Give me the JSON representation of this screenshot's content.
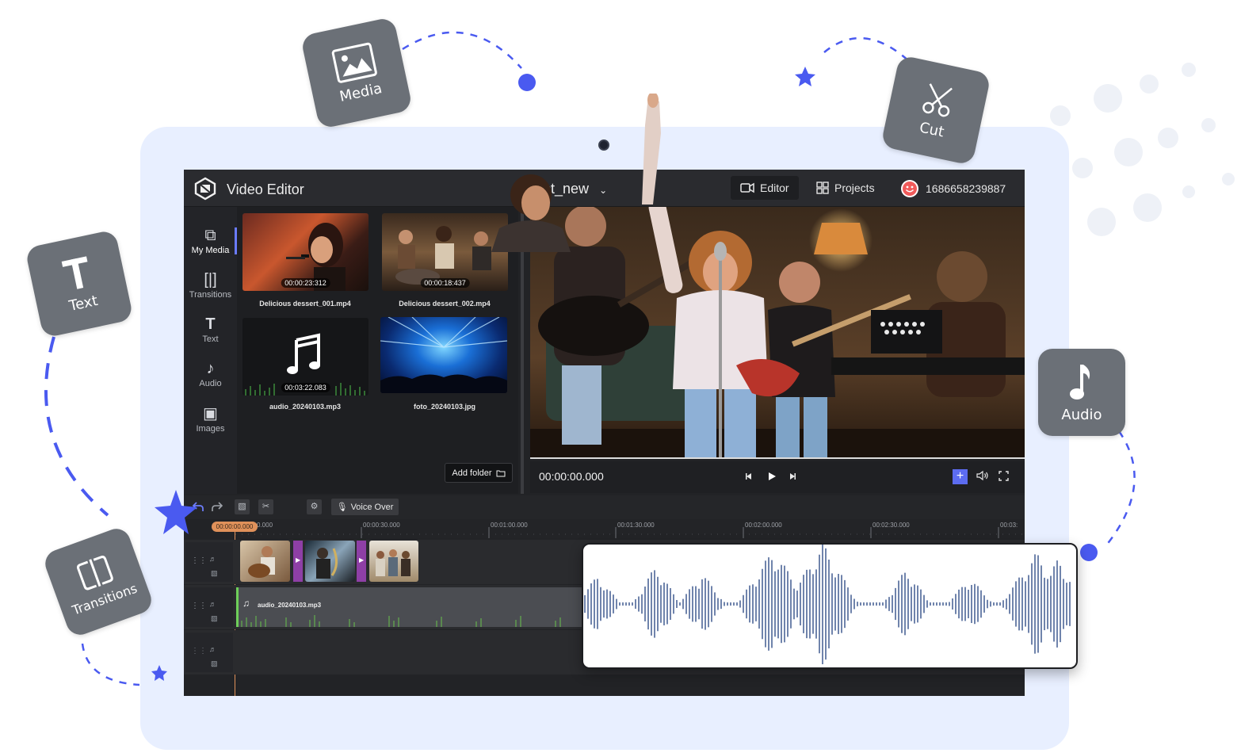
{
  "app": {
    "title": "Video Editor",
    "project_name": "ect_new",
    "tabs": [
      {
        "label": "Editor",
        "active": true
      },
      {
        "label": "Projects",
        "active": false
      }
    ],
    "user_id": "1686658239887"
  },
  "sidebar": {
    "items": [
      {
        "label": "My Media",
        "icon": "media-stack-icon",
        "active": true
      },
      {
        "label": "Transitions",
        "icon": "transition-icon",
        "active": false
      },
      {
        "label": "Text",
        "icon": "text-icon",
        "active": false
      },
      {
        "label": "Audio",
        "icon": "music-note-icon",
        "active": false
      },
      {
        "label": "Images",
        "icon": "image-icon",
        "active": false
      }
    ]
  },
  "media": {
    "items": [
      {
        "name": "Delicious dessert_001.mp4",
        "duration": "00:00:23:312",
        "kind": "video"
      },
      {
        "name": "Delicious dessert_002.mp4",
        "duration": "00:00:18:437",
        "kind": "video"
      },
      {
        "name": "audio_20240103.mp3",
        "duration": "00:03:22.083",
        "kind": "audio"
      },
      {
        "name": "foto_20240103.jpg",
        "duration": "",
        "kind": "image"
      }
    ],
    "add_folder_label": "Add folder"
  },
  "player": {
    "timecode": "00:00:00.000"
  },
  "timeline": {
    "voice_over_label": "Voice Over",
    "playhead_time": "00:00:00.000",
    "ruler_labels": [
      "00:00:30.000",
      "00:01:00.000",
      "00:01:30.000",
      "00:02:00.000",
      "00:02:30.000",
      "00:03:"
    ],
    "ruler_start_fragment": "0.000",
    "audio_clip_name": "audio_20240103.mp3"
  },
  "features": [
    {
      "label": "Media",
      "icon": "image-icon"
    },
    {
      "label": "Cut",
      "icon": "scissors-icon"
    },
    {
      "label": "Text",
      "icon": "text-icon"
    },
    {
      "label": "Audio",
      "icon": "music-note-icon"
    },
    {
      "label": "Transitions",
      "icon": "transition-icon"
    }
  ],
  "colors": {
    "accent": "#5c6cf0",
    "decor_blue": "#4a5af0",
    "tile_gray": "#6b7077",
    "tablet_bg": "#e8efff",
    "editor_bg": "#222326",
    "playhead": "#e0915a",
    "audio_clip_edge": "#6fcf5a",
    "transition_marker": "#8e3fa6",
    "waveform": "#4c6598"
  }
}
